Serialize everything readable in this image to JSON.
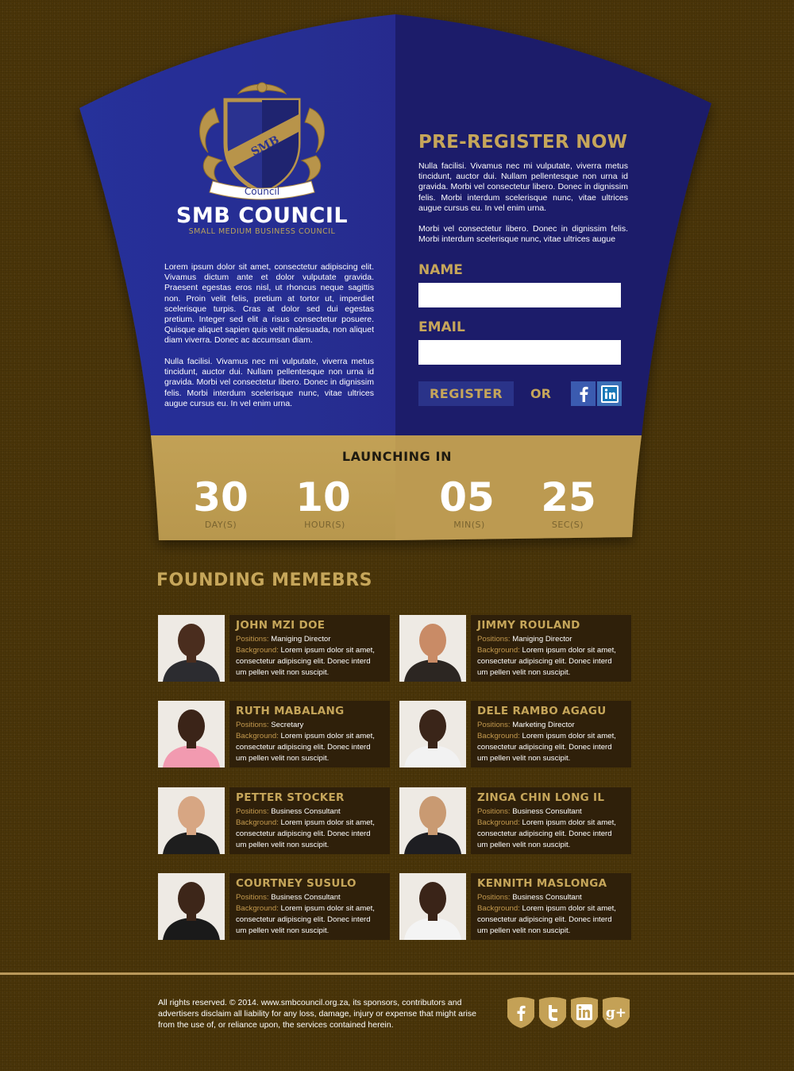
{
  "colors": {
    "background": "#4a3509",
    "navy": "#25288c",
    "navy_dark": "#1b1f6b",
    "gold": "#c6a65a",
    "gold_band": "#c5a459",
    "card": "#2f200a"
  },
  "brand": {
    "ribbon": "Council",
    "crest_text": "SMB",
    "title": "SMB COUNCIL",
    "subtitle": "SMALL MEDIUM BUSINESS COUNCIL"
  },
  "intro": {
    "p1": "Lorem ipsum dolor sit amet, consectetur adipiscing elit. Vivamus dictum ante et dolor vulputate gravida. Praesent egestas eros nisl, ut rhoncus neque sagittis non. Proin velit felis, pretium at tortor ut, imperdiet scelerisque turpis. Cras at dolor sed dui egestas pretium. Integer sed elit a risus consectetur posuere. Quisque aliquet sapien quis velit malesuada, non aliquet diam viverra. Donec ac accumsan diam.",
    "p2": "Nulla facilisi. Vivamus nec mi vulputate, viverra metus tincidunt, auctor dui. Nullam pellentesque non urna id gravida. Morbi vel consectetur libero. Donec in dignissim felis. Morbi interdum scelerisque nunc, vitae ultrices augue cursus eu. In vel enim urna."
  },
  "register": {
    "heading": "PRE-REGISTER NOW",
    "p1": "Nulla facilisi. Vivamus nec mi vulputate, viverra metus tincidunt, auctor dui. Nullam pellentesque non urna id gravida. Morbi vel consectetur libero. Donec in dignissim felis. Morbi interdum scelerisque nunc, vitae ultrices augue cursus eu. In vel enim urna.",
    "p2": "Morbi vel consectetur libero. Donec in dignissim felis. Morbi interdum scelerisque nunc, vitae ultrices augue",
    "name_label": "NAME",
    "name_value": "",
    "email_label": "EMAIL",
    "email_value": "",
    "button": "REGISTER",
    "or": "OR",
    "social": [
      "facebook-icon",
      "linkedin-icon"
    ]
  },
  "countdown": {
    "heading": "LAUNCHING IN",
    "days": "30",
    "days_label": "DAY(S)",
    "hours": "10",
    "hours_label": "HOUR(S)",
    "mins": "05",
    "mins_label": "MIN(S)",
    "secs": "25",
    "secs_label": "SEC(S)"
  },
  "members": {
    "heading": "FOUNDING MEMEBRS",
    "position_key": "Positions:",
    "background_key": "Background:",
    "background_line1": "Lorem ipsum dolor sit amet,",
    "background_line2": "consectetur adipiscing elit. Donec interd",
    "background_line3": "um pellen velit non suscipit.",
    "list": [
      {
        "name": "JOHN MZI DOE",
        "position": "Maniging Director"
      },
      {
        "name": "JIMMY ROULAND",
        "position": "Maniging Director"
      },
      {
        "name": "RUTH MABALANG",
        "position": "Secretary"
      },
      {
        "name": "DELE RAMBO AGAGU",
        "position": "Marketing Director"
      },
      {
        "name": "PETTER STOCKER",
        "position": "Business Consultant"
      },
      {
        "name": "ZINGA CHIN LONG IL",
        "position": "Business Consultant"
      },
      {
        "name": "COURTNEY SUSULO",
        "position": "Business Consultant"
      },
      {
        "name": "KENNITH MASLONGA",
        "position": "Business Consultant"
      }
    ]
  },
  "footer": {
    "text": "All rights reserved. © 2014. www.smbcouncil.org.za, its sponsors, contributors and advertisers disclaim all liability for any loss, damage, injury or expense that might arise from the use of, or reliance upon, the services contained herein.",
    "icons": [
      "facebook-icon",
      "twitter-icon",
      "linkedin-icon",
      "google-plus-icon"
    ]
  }
}
